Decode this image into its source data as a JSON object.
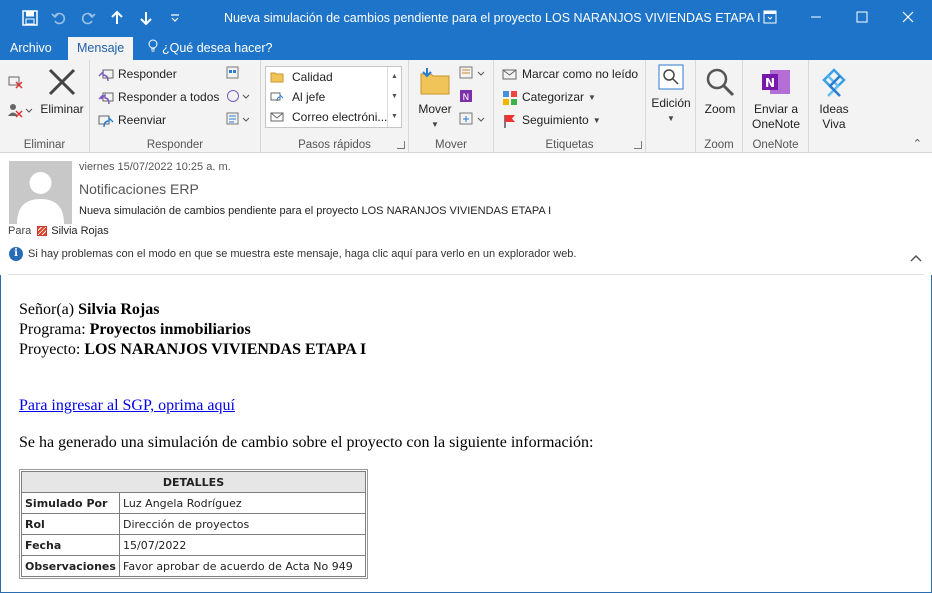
{
  "window": {
    "title": "Nueva simulación de cambios pendiente para el proyecto LOS NARANJOS VIVIENDAS ETAPA I"
  },
  "tabs": [
    "Archivo",
    "Mensaje"
  ],
  "active_tab": "Mensaje",
  "tell_me": "¿Qué desea hacer?",
  "ribbon": {
    "eliminar": {
      "delete_label": "Eliminar",
      "group": "Eliminar"
    },
    "responder": {
      "reply": "Responder",
      "reply_all": "Responder a todos",
      "forward": "Reenviar",
      "group": "Responder"
    },
    "quick_steps": {
      "items": [
        "Calidad",
        "Al jefe",
        "Correo electróni..."
      ],
      "group": "Pasos rápidos"
    },
    "mover": {
      "move": "Mover",
      "group": "Mover"
    },
    "etiquetas": {
      "mark_unread": "Marcar como no leído",
      "categorize": "Categorizar",
      "followup": "Seguimiento",
      "group": "Etiquetas"
    },
    "edicion": {
      "label": "Edición"
    },
    "zoom": {
      "label": "Zoom",
      "group": "Zoom"
    },
    "onenote": {
      "label1": "Enviar a",
      "label2": "OneNote",
      "group": "OneNote"
    },
    "ideas": {
      "label1": "Ideas",
      "label2": "Viva"
    }
  },
  "header": {
    "date": "viernes 15/07/2022 10:25 a. m.",
    "from": "Notificaciones ERP",
    "subject": "Nueva simulación de cambios pendiente para el proyecto LOS NARANJOS VIVIENDAS ETAPA I",
    "to_label": "Para",
    "to_name": "Silvia Rojas",
    "info": "Si hay problemas con el modo en que se muestra este mensaje, haga clic aquí para verlo en un explorador web."
  },
  "body": {
    "l1_prefix": "Señor(a) ",
    "l1_value": "Silvia Rojas",
    "l2_prefix": "Programa: ",
    "l2_value": "Proyectos inmobiliarios",
    "l3_prefix": "Proyecto: ",
    "l3_value": "LOS NARANJOS VIVIENDAS ETAPA I",
    "link": "Para ingresar al SGP, oprima aquí",
    "intro": "Se ha generado una simulación de cambio sobre el proyecto con la siguiente información:",
    "table_title": "DETALLES",
    "rows": [
      {
        "k": "Simulado Por",
        "v": "Luz Angela Rodríguez"
      },
      {
        "k": "Rol",
        "v": "Dirección de proyectos"
      },
      {
        "k": "Fecha",
        "v": "15/07/2022"
      },
      {
        "k": "Observaciones",
        "v": "Favor aprobar de acuerdo de Acta No 949"
      }
    ]
  },
  "colors": {
    "accent": "#1e74c8",
    "link": "#0000ee"
  }
}
